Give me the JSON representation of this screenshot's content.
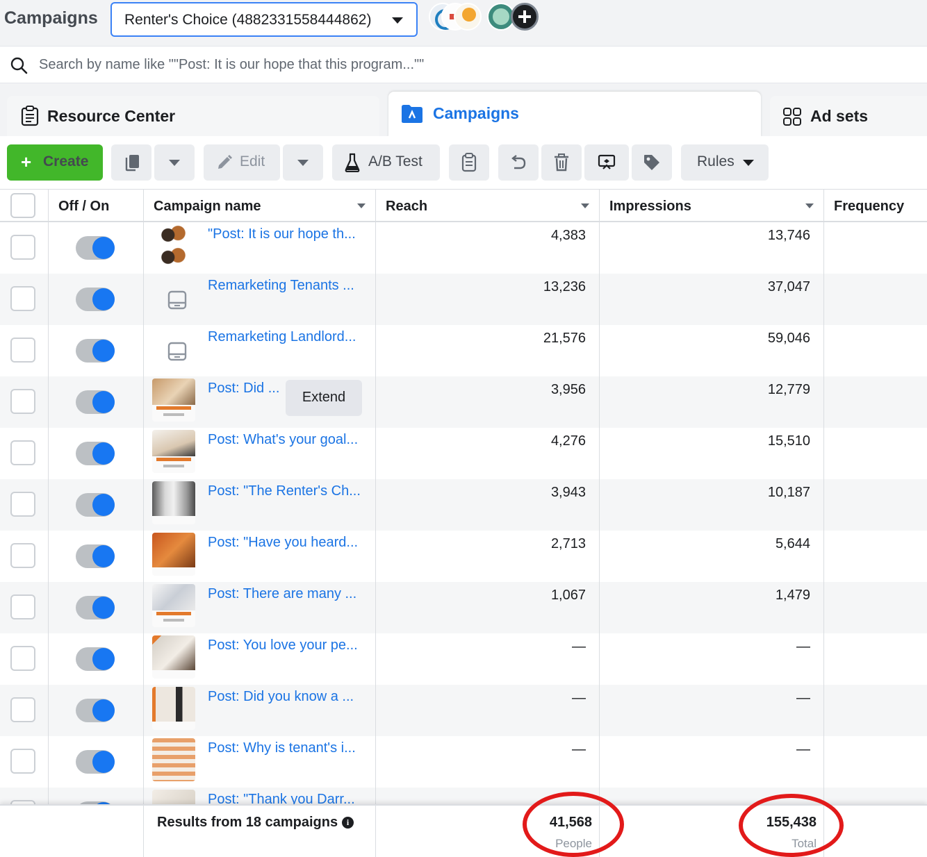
{
  "header": {
    "title": "Campaigns",
    "account_selector": "Renter's Choice (4882331558444862)"
  },
  "search": {
    "placeholder": "Search by name like \"\"Post: It is our hope that this program...\"\""
  },
  "tabs": [
    {
      "label": "Resource Center",
      "active": false
    },
    {
      "label": "Campaigns",
      "active": true
    },
    {
      "label": "Ad sets",
      "active": false
    }
  ],
  "toolbar": {
    "create_label": "Create",
    "edit_label": "Edit",
    "ab_test_label": "A/B Test",
    "rules_label": "Rules"
  },
  "columns": {
    "off_on": "Off / On",
    "campaign_name": "Campaign name",
    "reach": "Reach",
    "impressions": "Impressions",
    "frequency": "Frequency"
  },
  "rows": [
    {
      "name": "\"Post: It is our hope th...",
      "reach": "4,383",
      "impressions": "13,746",
      "on": true
    },
    {
      "name": "Remarketing Tenants ...",
      "reach": "13,236",
      "impressions": "37,047",
      "on": true
    },
    {
      "name": "Remarketing Landlord...",
      "reach": "21,576",
      "impressions": "59,046",
      "on": true
    },
    {
      "name": "Post: Did ...",
      "reach": "3,956",
      "impressions": "12,779",
      "on": true,
      "tooltip": "Extend"
    },
    {
      "name": "Post: What's your goal...",
      "reach": "4,276",
      "impressions": "15,510",
      "on": true
    },
    {
      "name": "Post: \"The Renter's Ch...",
      "reach": "3,943",
      "impressions": "10,187",
      "on": true
    },
    {
      "name": "Post: \"Have you heard...",
      "reach": "2,713",
      "impressions": "5,644",
      "on": true
    },
    {
      "name": "Post: There are many ...",
      "reach": "1,067",
      "impressions": "1,479",
      "on": true
    },
    {
      "name": "Post: You love your pe...",
      "reach": "—",
      "impressions": "—",
      "on": true
    },
    {
      "name": "Post: Did you know a ...",
      "reach": "—",
      "impressions": "—",
      "on": true
    },
    {
      "name": "Post: Why is tenant's i...",
      "reach": "—",
      "impressions": "—",
      "on": true
    },
    {
      "name": "Post: \"Thank you Darr...",
      "reach": "",
      "impressions": "",
      "on": true
    }
  ],
  "footer": {
    "results_label": "Results from 18 campaigns",
    "reach_total": "41,568",
    "reach_unit": "People",
    "impressions_total": "155,438",
    "impressions_unit": "Total"
  },
  "colors": {
    "accent_blue": "#1b74e4",
    "create_green": "#42b72a",
    "toggle_on": "#1877f2",
    "highlight_red": "#e21a1a"
  }
}
